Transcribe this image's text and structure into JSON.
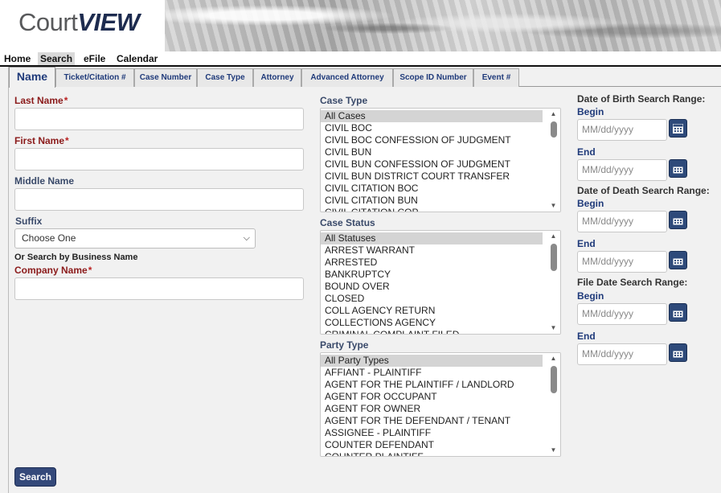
{
  "logo": {
    "part1": "Court",
    "part2": "VIEW"
  },
  "topnav": [
    "Home",
    "Search",
    "eFile",
    "Calendar"
  ],
  "tabs": [
    "Name",
    "Ticket/Citation #",
    "Case Number",
    "Case Type",
    "Attorney",
    "Advanced Attorney",
    "Scope ID Number",
    "Event #"
  ],
  "form": {
    "last_name_label": "Last Name",
    "first_name_label": "First Name",
    "middle_name_label": "Middle Name",
    "suffix_label": "Suffix",
    "suffix_value": "Choose One",
    "business_hint": "Or Search by Business Name",
    "company_name_label": "Company Name",
    "required_mark": "*",
    "search_button": "Search"
  },
  "case_type": {
    "label": "Case Type",
    "options": [
      "All Cases",
      "CIVIL BOC",
      "CIVIL BOC CONFESSION OF JUDGMENT",
      "CIVIL BUN",
      "CIVIL BUN CONFESSION OF JUDGMENT",
      "CIVIL BUN DISTRICT COURT TRANSFER",
      "CIVIL CITATION BOC",
      "CIVIL CITATION BUN",
      "CIVIL CITATION COP"
    ],
    "selected": "All Cases"
  },
  "case_status": {
    "label": "Case Status",
    "options": [
      "All Statuses",
      "ARREST WARRANT",
      "ARRESTED",
      "BANKRUPTCY",
      "BOUND OVER",
      "CLOSED",
      "COLL AGENCY RETURN",
      "COLLECTIONS AGENCY",
      "CRIMINAL COMPLAINT FILED"
    ],
    "selected": "All Statuses"
  },
  "party_type": {
    "label": "Party Type",
    "options": [
      "All Party Types",
      "AFFIANT - PLAINTIFF",
      "AGENT FOR THE PLAINTIFF / LANDLORD",
      "AGENT FOR OCCUPANT",
      "AGENT FOR OWNER",
      "AGENT FOR THE DEFENDANT / TENANT",
      "ASSIGNEE - PLAINTIFF",
      "COUNTER DEFENDANT",
      "COUNTER PLAINTIFF"
    ],
    "selected": "All Party Types"
  },
  "dates": {
    "dob_label": "Date of Birth Search Range:",
    "dod_label": "Date of Death Search Range:",
    "file_label": "File Date Search Range:",
    "begin": "Begin",
    "end": "End",
    "placeholder": "MM/dd/yyyy"
  },
  "colors": {
    "accent": "#34497a",
    "required": "#8b1a1a",
    "tab_text": "#1f3a7a"
  }
}
